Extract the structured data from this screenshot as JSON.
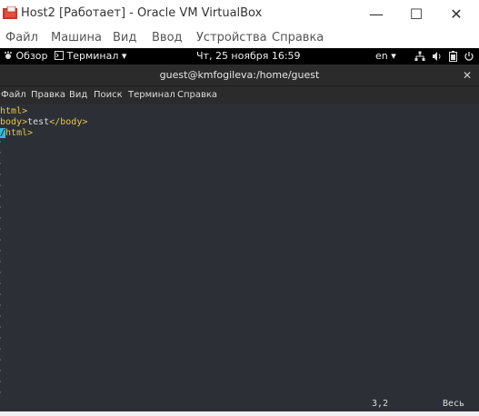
{
  "window": {
    "title": "Host2 [Работает] - Oracle VM VirtualBox",
    "min_glyph": "—",
    "max_glyph": "☐",
    "close_glyph": "✕"
  },
  "vbox_menu": {
    "items": [
      "Файл",
      "Машина",
      "Вид",
      "Ввод",
      "Устройства",
      "Справка"
    ]
  },
  "gnome_bar": {
    "activities": "Обзор",
    "app_menu": "Терминал",
    "clock": "Чт, 25 ноября  16:59",
    "keyboard_layout": "en",
    "icons": [
      "network-icon",
      "volume-icon",
      "battery-icon",
      "power-icon"
    ]
  },
  "terminal": {
    "title": "guest@kmfogileva:/home/guest",
    "menu": [
      "Файл",
      "Правка",
      "Вид",
      "Поиск",
      "Терминал",
      "Справка"
    ],
    "lines": [
      {
        "a": "html",
        "b": ">",
        "c": "",
        "d": ""
      },
      {
        "a": "body",
        "b": ">",
        "c": "test",
        "d": "</body>"
      },
      {
        "a": "/",
        "b": "html>",
        "c": "",
        "d": ""
      }
    ],
    "cursor_pos": "3,2",
    "view_mode": "Весь"
  },
  "colors": {
    "terminal_bg": "#2c3036",
    "tag_color": "#e8c44c",
    "cursor_color": "#37b7d8",
    "gnome_bar_bg": "#000000"
  }
}
